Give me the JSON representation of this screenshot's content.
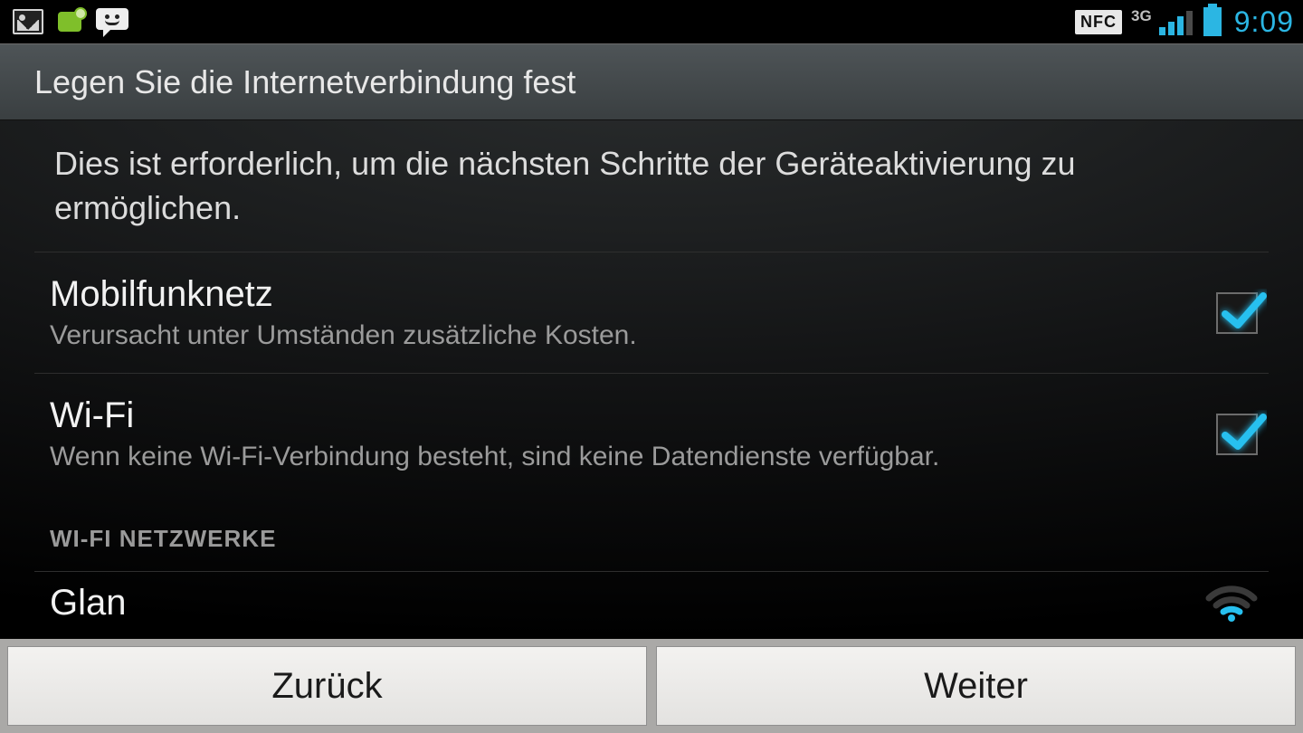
{
  "statusbar": {
    "nfc_label": "NFC",
    "network_label": "3G",
    "clock": "9:09"
  },
  "title": "Legen Sie die Internetverbindung fest",
  "intro": "Dies ist erforderlich, um die nächsten Schritte der Geräteaktivierung zu ermöglichen.",
  "options": {
    "mobile": {
      "title": "Mobilfunknetz",
      "subtitle": "Verursacht unter Umständen zusätzliche Kosten.",
      "checked": true
    },
    "wifi": {
      "title": "Wi-Fi",
      "subtitle": "Wenn keine Wi-Fi-Verbindung besteht, sind keine Datendienste verfügbar.",
      "checked": true
    }
  },
  "wifi_section_header": "WI-FI NETZWERKE",
  "wifi_networks": [
    {
      "name": "Glan"
    }
  ],
  "buttons": {
    "back": "Zurück",
    "next": "Weiter"
  }
}
